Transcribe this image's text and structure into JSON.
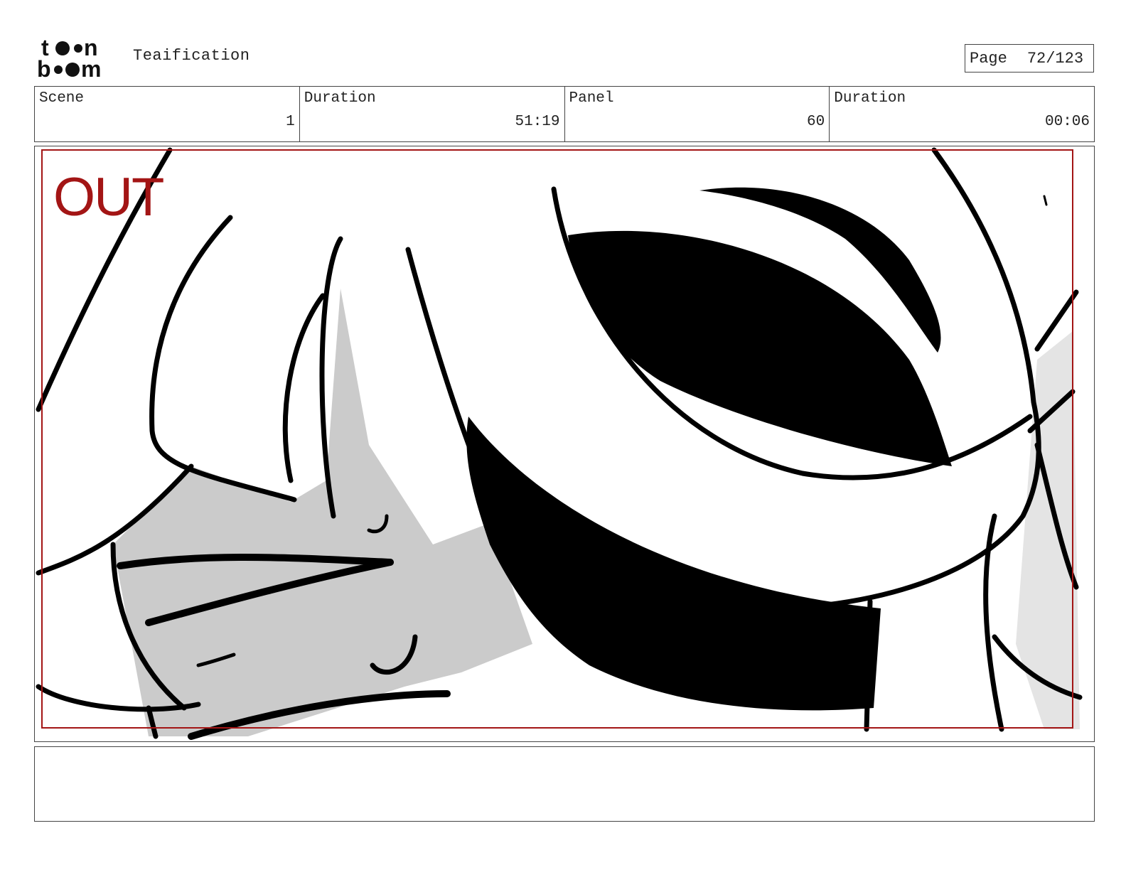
{
  "header": {
    "logo": "toon boom",
    "project_title": "Teaification",
    "page_label": "Page",
    "page_value": "72/123"
  },
  "info": {
    "scene_label": "Scene",
    "scene_value": "1",
    "scene_duration_label": "Duration",
    "scene_duration_value": "51:19",
    "panel_label": "Panel",
    "panel_value": "60",
    "panel_duration_label": "Duration",
    "panel_duration_value": "00:06"
  },
  "panel": {
    "camera_label": "OUT",
    "camera_color": "#a31515",
    "art_description_icon": "sketch-drawing"
  },
  "notes": {
    "text": ""
  }
}
